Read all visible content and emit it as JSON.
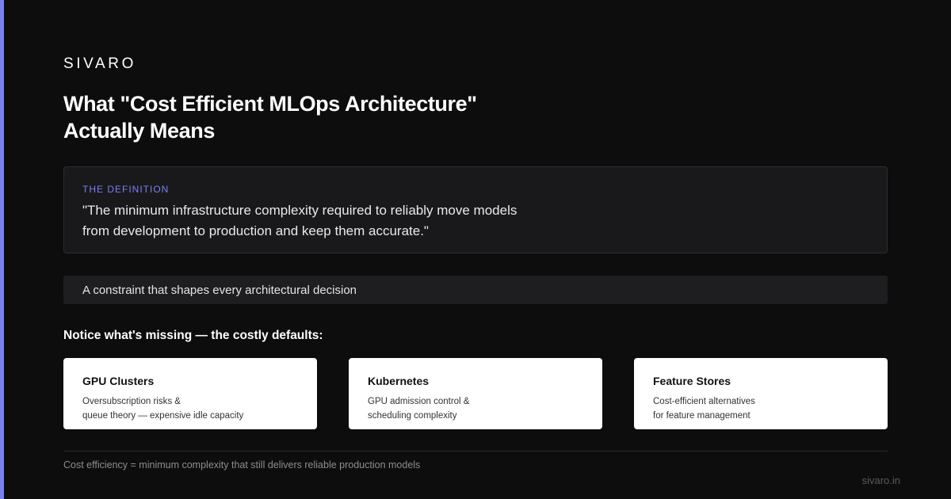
{
  "brand": "SIVARO",
  "title_line1": "What \"Cost Efficient MLOps Architecture\"",
  "title_line2": "Actually Means",
  "definition": {
    "label": "THE DEFINITION",
    "quote_line1": "\"The minimum infrastructure complexity required to reliably move models",
    "quote_line2": "from development to production and keep them accurate.\""
  },
  "constraint": "A constraint that shapes every architectural decision",
  "missing_heading": "Notice what's missing — the costly defaults:",
  "cards": [
    {
      "title": "GPU Clusters",
      "desc_line1": "Oversubscription risks &",
      "desc_line2": "queue theory — expensive idle capacity"
    },
    {
      "title": "Kubernetes",
      "desc_line1": "GPU admission control &",
      "desc_line2": "scheduling complexity"
    },
    {
      "title": "Feature Stores",
      "desc_line1": "Cost-efficient alternatives",
      "desc_line2": "for feature management"
    }
  ],
  "footer_note": "Cost efficiency = minimum complexity that still delivers reliable production models",
  "site_url": "sivaro.in",
  "colors": {
    "background": "#0d0d0e",
    "accent": "#7b7ff0",
    "card_background": "#ffffff"
  }
}
